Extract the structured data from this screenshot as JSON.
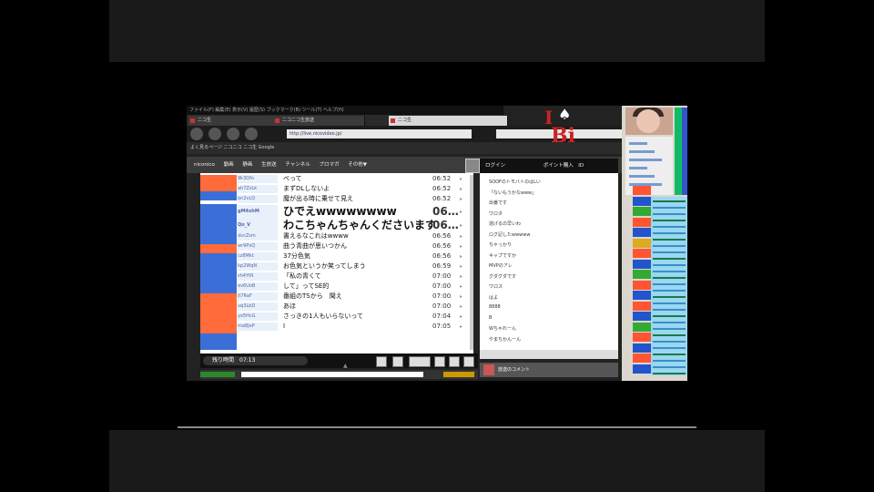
{
  "browser": {
    "menubar": "ファイル(F)  編集(E)  表示(V)  履歴(S)  ブックマーク(B)  ツール(T)  ヘルプ(H)",
    "tabs": [
      {
        "label": "ニコ生",
        "active": false
      },
      {
        "label": "ニコニコ生放送",
        "active": false
      },
      {
        "label": "ニコ生",
        "active": true
      }
    ],
    "address": "http://live.nicovideo.jp/",
    "bookmarks": "よく見るページ  ニコニコ  ニコ生  Google",
    "site_nav": [
      "niconico",
      "動画",
      "静画",
      "生放送",
      "チャンネル",
      "ブロマガ",
      "その他▼"
    ]
  },
  "logo": {
    "char1": "I",
    "char2": "Bi",
    "spade": "♠"
  },
  "comments": [
    {
      "user": "9k3Dfo",
      "text": "ぺって",
      "time": "06:52",
      "big": false
    },
    {
      "user": "ah7ZzLk",
      "text": "まずDLしないよ",
      "time": "06:52",
      "big": false
    },
    {
      "user": "bn2vLQ",
      "text": "魔が出る時に乗せて見え",
      "time": "06:52",
      "big": false
    },
    {
      "user": "gM4xhM",
      "text": "ひでえwwwwwwww",
      "time": "06…",
      "big": true
    },
    {
      "user": "Qo_V",
      "text": "わこちゃんちゃんくださいます",
      "time": "06…",
      "big": true
    },
    {
      "user": "dvcZsm",
      "text": "書えるなこれはwwww",
      "time": "06:56",
      "big": false
    },
    {
      "user": "wr9PxQ",
      "text": "曲う青曲が思いつかん",
      "time": "06:56",
      "big": false
    },
    {
      "user": "cz8Mkt",
      "text": "37分色気",
      "time": "06:56",
      "big": false
    },
    {
      "user": "kp2WqN",
      "text": "お色気というか笑ってしまう",
      "time": "06:59",
      "big": false
    },
    {
      "user": "sh4YtR",
      "text": "「私の青くて",
      "time": "07:00",
      "big": false
    },
    {
      "user": "ev6UoB",
      "text": "して」ってSE的",
      "time": "07:00",
      "big": false
    },
    {
      "user": "jt7RaF",
      "text": "番組のTSから　聞え",
      "time": "07:00",
      "big": false
    },
    {
      "user": "uq3LbD",
      "text": "あほ",
      "time": "07:00",
      "big": false
    },
    {
      "user": "yx5HcG",
      "text": "さっきの1人もいらないって",
      "time": "07:04",
      "big": false
    },
    {
      "user": "ma8JeP",
      "text": "I",
      "time": "07:05",
      "big": false
    }
  ],
  "player": {
    "time_label": "残り時間　07:13",
    "arrow": "▲"
  },
  "chat": {
    "header": "ログイン",
    "header_right": "ポイント購入　ID",
    "lines": [
      "SOOFのトモバトのはLい",
      "「ないもうかなwww」",
      "出番です",
      "ワロタ",
      "逃げるの早いわ",
      "ログ記したwwwww",
      "ちゃっかり",
      "キャプですか",
      "MVPのアレ",
      "グダグダです",
      "ワロス",
      "はよ",
      "8888",
      "B",
      "Wちゃれーん",
      "やまちかんーん"
    ],
    "post_label": "放送のコメント"
  }
}
